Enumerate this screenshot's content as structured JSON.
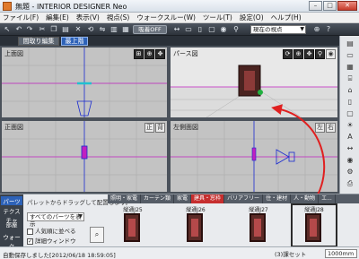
{
  "window": {
    "title": "無題 - INTERIOR DESIGNER Neo",
    "min": "–",
    "max": "□",
    "close": "✕"
  },
  "menu": [
    "ファイル(F)",
    "編集(E)",
    "表示(V)",
    "視点(S)",
    "ウォークスルー(W)",
    "ツール(T)",
    "設定(O)",
    "ヘルプ(H)"
  ],
  "toolbar": {
    "toggle_label": "吸着OFF",
    "viewpoint_select": "現在の視点"
  },
  "floor_tabs": {
    "inactive": "間取り編集",
    "active": "最上階"
  },
  "views": {
    "top": {
      "label": "上面図"
    },
    "perspective": {
      "label": "パース図"
    },
    "front": {
      "label": "正面図",
      "tools": [
        "正",
        "背"
      ]
    },
    "side": {
      "label": "左側面図",
      "tools": [
        "左",
        "右"
      ]
    }
  },
  "palette": {
    "info": "パレットからドラッグして配置します。",
    "select": "すべてのパーツを表示",
    "check1": "人気順に並べる",
    "check2": "詳細ウィンドウ",
    "search_icon": "search-icon",
    "left_tabs": [
      "パーツ",
      "テクスチャ",
      "部屋",
      "ウォーク"
    ],
    "categories": [
      "照明・家電",
      "カーテン類",
      "家電",
      "建具・窓枠",
      "バリアフリー",
      "住・建材",
      "人・動物",
      "エ..."
    ],
    "active_category": 3,
    "items": [
      "縦通J25",
      "縦通J26",
      "縦通J27",
      "縦通J28"
    ]
  },
  "status": {
    "left": "自動保存しました[2012/06/18 18:59:05]",
    "right": "(3)課セット",
    "unit": "1000mm"
  },
  "colors": {
    "accent_blue": "#2d62b8",
    "arrow_red": "#e02020",
    "object_magenta": "#c020c0",
    "object_blue": "#1a2bd0"
  }
}
